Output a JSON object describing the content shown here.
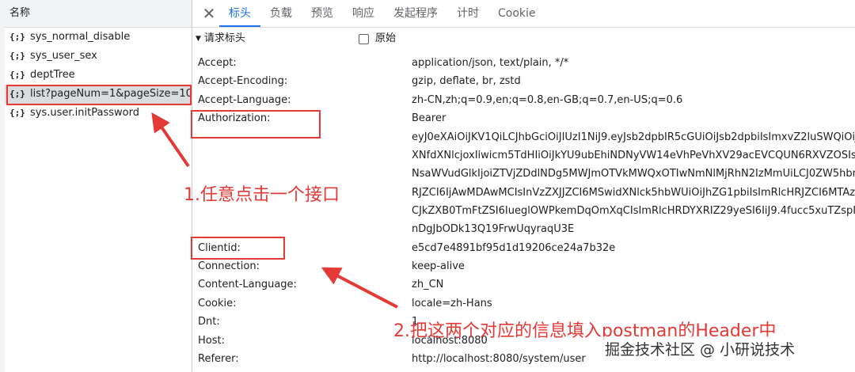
{
  "sidebar": {
    "header": "名称",
    "icon_glyph": "{;}",
    "items": [
      {
        "label": "sys_normal_disable"
      },
      {
        "label": "sys_user_sex"
      },
      {
        "label": "deptTree"
      },
      {
        "label": "list?pageNum=1&pageSize=10",
        "selected": true
      },
      {
        "label": "sys.user.initPassword"
      }
    ]
  },
  "tabs": {
    "close_glyph": "✕",
    "items": [
      "标头",
      "负载",
      "预览",
      "响应",
      "发起程序",
      "计时",
      "Cookie"
    ],
    "active": "标头"
  },
  "section": {
    "triangle": "▼",
    "title": "请求标头",
    "raw_label": "原始"
  },
  "headers": [
    {
      "name": "Accept:",
      "value": "application/json, text/plain, */*"
    },
    {
      "name": "Accept-Encoding:",
      "value": "gzip, deflate, br, zstd"
    },
    {
      "name": "Accept-Language:",
      "value": "zh-CN,zh;q=0.9,en;q=0.8,en-GB;q=0.7,en-US;q=0.6"
    },
    {
      "name": "Authorization:",
      "value": "Bearer"
    }
  ],
  "auth_token_lines": [
    "eyJ0eXAiOiJKV1QiLCJhbGciOiJIUzI1NiJ9.eyJsb2dpbIR5cGUiOiJsb2dpbiIsImxvZ2luSWQiOiJzeXN",
    "XNfdXNlcjoxIiwicm5TdHIiOiJkYU9ubEhiNDNyVW14eVhPeVhXV29acEVCQUN6RXVZOSIsIm",
    "NsaWVudGlkIjoiZTVjZDdlNDg5MWJmOTVkMWQxOTIwNmNlMjRhN2IzMmUiLCJ0ZW5hbnRJ",
    "RJZCI6IjAwMDAwMCIsInVzZXJJZCI6MSwidXNlck5hbWUiOiJhZG1pbiIsImRlcHRJZCI6MTAzL",
    "CJkZXB0TmFtZSI6IueglOWPkemDqOmXqCIsImRlcHRDYXRIZ29yeSI6IiJ9.4fucc5xuTZspILi544",
    "nDgJbODk13Q19FrwUqyraqU3E"
  ],
  "headers2": [
    {
      "name": "Clientid:",
      "value": "e5cd7e4891bf95d1d19206ce24a7b32e"
    },
    {
      "name": "Connection:",
      "value": "keep-alive"
    },
    {
      "name": "Content-Language:",
      "value": "zh_CN"
    },
    {
      "name": "Cookie:",
      "value": "locale=zh-Hans"
    },
    {
      "name": "Dnt:",
      "value": "1"
    },
    {
      "name": "Host:",
      "value": "localhost:8080"
    },
    {
      "name": "Referer:",
      "value": "http://localhost:8080/system/user"
    }
  ],
  "annotations": {
    "note1": "1.任意点击一个接口",
    "note2": "2.把这两个对应的信息填入postman的Header中",
    "color": "#e53935"
  },
  "watermark": "掘金技术社区 @ 小研说技术"
}
